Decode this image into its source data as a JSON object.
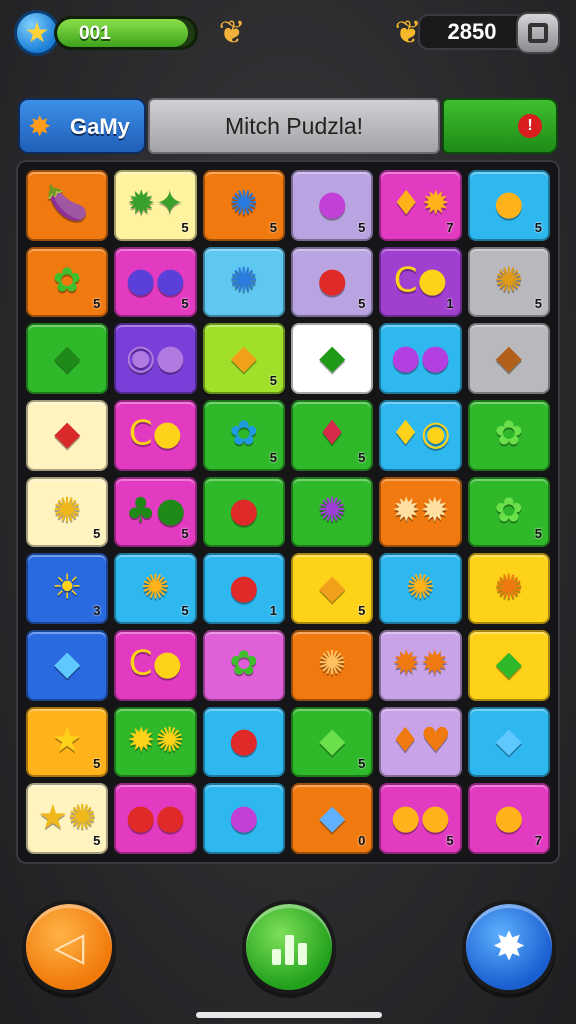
{
  "hud": {
    "level_text": "001",
    "level_progress": 0.95,
    "coins": "2850",
    "star_icon": "star-icon",
    "shell_icon": "shell-icon",
    "coin_icon": "coin-icon"
  },
  "titlebar": {
    "game_label": "GaMy",
    "title": "Mitch Pudzla!",
    "alert": "!"
  },
  "board": {
    "columns": 6,
    "rows": 9,
    "tiles": [
      {
        "bg": "#f07a10",
        "sym": "🍆",
        "color": "#9b3fd8",
        "num": ""
      },
      {
        "bg": "#fff3a0",
        "sym": "✹✦",
        "color": "#3aa02c",
        "num": "5"
      },
      {
        "bg": "#f07a10",
        "sym": "✺",
        "color": "#2a7ae0",
        "num": "5"
      },
      {
        "bg": "#b9a3e0",
        "sym": "●",
        "color": "#c23fd8",
        "num": "5"
      },
      {
        "bg": "#e23bc2",
        "sym": "♦✹",
        "color": "#ffb21a",
        "num": "7"
      },
      {
        "bg": "#2fb8f0",
        "sym": "●",
        "color": "#ffb21a",
        "num": "5"
      },
      {
        "bg": "#f07a10",
        "sym": "✿",
        "color": "#3fbf2e",
        "num": "5"
      },
      {
        "bg": "#e23bc2",
        "sym": "●●",
        "color": "#5a3fd8",
        "num": "5"
      },
      {
        "bg": "#5fc8f0",
        "sym": "✺",
        "color": "#2a7ae0",
        "num": ""
      },
      {
        "bg": "#b9a3e0",
        "sym": "●",
        "color": "#e02a2a",
        "num": "5"
      },
      {
        "bg": "#a03fd0",
        "sym": "C●",
        "color": "#ffd21a",
        "num": "1"
      },
      {
        "bg": "#b9b9bd",
        "sym": "✺",
        "color": "#e09a1a",
        "num": "5"
      },
      {
        "bg": "#2fb82a",
        "sym": "◆",
        "color": "#1f8a18",
        "num": ""
      },
      {
        "bg": "#7a3fd8",
        "sym": "◉●",
        "color": "#b07ae0",
        "num": ""
      },
      {
        "bg": "#a0e02a",
        "sym": "◆",
        "color": "#f0a01a",
        "num": "5"
      },
      {
        "bg": "#ffffff",
        "sym": "◆",
        "color": "#1f9a18",
        "num": ""
      },
      {
        "bg": "#2fb8f0",
        "sym": "●●",
        "color": "#b43fe0",
        "num": ""
      },
      {
        "bg": "#b9b9bd",
        "sym": "◆",
        "color": "#b0601a",
        "num": ""
      },
      {
        "bg": "#fff3c0",
        "sym": "◆",
        "color": "#d82a2a",
        "num": ""
      },
      {
        "bg": "#e23bc2",
        "sym": "C●",
        "color": "#ffd21a",
        "num": ""
      },
      {
        "bg": "#2fb82a",
        "sym": "✿",
        "color": "#1f9ae0",
        "num": "5"
      },
      {
        "bg": "#2fb82a",
        "sym": "♦",
        "color": "#d82a4a",
        "num": "5"
      },
      {
        "bg": "#2fb8f0",
        "sym": "♦◉",
        "color": "#ffd21a",
        "num": ""
      },
      {
        "bg": "#2fb82a",
        "sym": "✿",
        "color": "#6be04a",
        "num": ""
      },
      {
        "bg": "#fff3c0",
        "sym": "✺",
        "color": "#f0b81a",
        "num": "5"
      },
      {
        "bg": "#e23bc2",
        "sym": "♣●",
        "color": "#1f8a18",
        "num": "5"
      },
      {
        "bg": "#2fb82a",
        "sym": "●",
        "color": "#e02a2a",
        "num": ""
      },
      {
        "bg": "#2fb82a",
        "sym": "✺",
        "color": "#a03fd8",
        "num": ""
      },
      {
        "bg": "#f07a10",
        "sym": "✹✹",
        "color": "#ffe0a0",
        "num": ""
      },
      {
        "bg": "#2fb82a",
        "sym": "✿",
        "color": "#6be04a",
        "num": "5"
      },
      {
        "bg": "#2a6ae0",
        "sym": "☀",
        "color": "#ffd21a",
        "num": "3"
      },
      {
        "bg": "#2fb8f0",
        "sym": "✺",
        "color": "#ffb21a",
        "num": "5"
      },
      {
        "bg": "#2fb8f0",
        "sym": "●",
        "color": "#e02a2a",
        "num": "1"
      },
      {
        "bg": "#ffd21a",
        "sym": "◆",
        "color": "#f0a01a",
        "num": "5"
      },
      {
        "bg": "#2fb8f0",
        "sym": "✺",
        "color": "#ffb21a",
        "num": ""
      },
      {
        "bg": "#ffd21a",
        "sym": "✺",
        "color": "#f07a10",
        "num": ""
      },
      {
        "bg": "#2a6ae0",
        "sym": "◆",
        "color": "#5fc8ff",
        "num": ""
      },
      {
        "bg": "#e23bc2",
        "sym": "C●",
        "color": "#ffd21a",
        "num": ""
      },
      {
        "bg": "#e060d8",
        "sym": "✿",
        "color": "#3fbf2e",
        "num": ""
      },
      {
        "bg": "#f07a10",
        "sym": "✺",
        "color": "#ffc060",
        "num": ""
      },
      {
        "bg": "#c9a3e8",
        "sym": "✹✹",
        "color": "#f07a10",
        "num": ""
      },
      {
        "bg": "#ffd21a",
        "sym": "◆",
        "color": "#2fb82a",
        "num": ""
      },
      {
        "bg": "#ffb21a",
        "sym": "★",
        "color": "#ffd21a",
        "num": "5"
      },
      {
        "bg": "#2fb82a",
        "sym": "✹✺",
        "color": "#ffd21a",
        "num": ""
      },
      {
        "bg": "#2fb8f0",
        "sym": "●",
        "color": "#e02a2a",
        "num": ""
      },
      {
        "bg": "#2fb82a",
        "sym": "◆",
        "color": "#6be04a",
        "num": "5"
      },
      {
        "bg": "#c9a3e8",
        "sym": "♦♥",
        "color": "#f07a10",
        "num": ""
      },
      {
        "bg": "#2fb8f0",
        "sym": "◆",
        "color": "#5fc8ff",
        "num": ""
      },
      {
        "bg": "#fff3c0",
        "sym": "★✺",
        "color": "#f0b81a",
        "num": "5"
      },
      {
        "bg": "#e23bc2",
        "sym": "●●",
        "color": "#e02a2a",
        "num": ""
      },
      {
        "bg": "#2fb8f0",
        "sym": "●",
        "color": "#c23fd8",
        "num": ""
      },
      {
        "bg": "#f07a10",
        "sym": "◆",
        "color": "#5fb0ff",
        "num": "0"
      },
      {
        "bg": "#e23bc2",
        "sym": "●●",
        "color": "#ffb21a",
        "num": "5"
      },
      {
        "bg": "#e23bc2",
        "sym": "●",
        "color": "#ffb21a",
        "num": "7"
      }
    ]
  },
  "controls": {
    "back_icon": "back-triangle-icon",
    "stats_icon": "bar-chart-icon",
    "badge_icon": "star-badge-icon",
    "back_glyph": "◁",
    "badge_glyph": "✸"
  }
}
